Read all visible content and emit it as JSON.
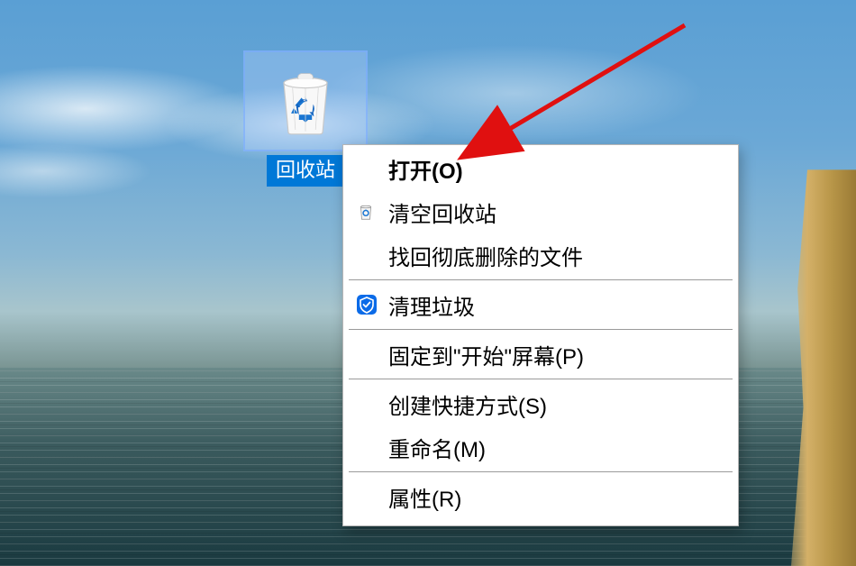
{
  "desktop": {
    "recycle_bin_label": "回收站"
  },
  "context_menu": {
    "open": "打开(O)",
    "empty_recycle_bin": "清空回收站",
    "recover_deleted_files": "找回彻底删除的文件",
    "clean_junk": "清理垃圾",
    "pin_to_start": "固定到\"开始\"屏幕(P)",
    "create_shortcut": "创建快捷方式(S)",
    "rename": "重命名(M)",
    "properties": "属性(R)"
  },
  "icons": {
    "recycle_bin": "recycle-bin-icon",
    "small_bin": "small-recycle-bin-icon",
    "tencent_shield": "tencent-shield-icon"
  },
  "annotation": {
    "arrow_color": "#e01010"
  }
}
